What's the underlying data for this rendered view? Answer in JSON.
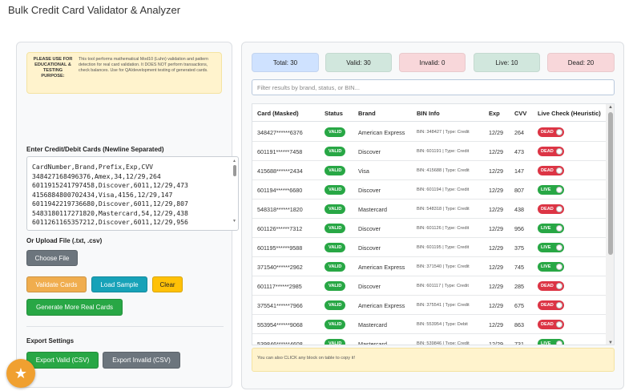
{
  "app": {
    "title": "Bulk Credit Card Validator & Analyzer"
  },
  "notice": {
    "title": "PLEASE USE FOR EDUCATIONAL & TESTING PURPOSE:",
    "text": "This tool performs mathematical Mod10 (Luhn) validation and pattern detection for real card validation. It DOES NOT perform transactions, check balances. Use for QA/development testing of generated cards."
  },
  "input": {
    "label": "Enter Credit/Debit Cards (Newline Separated)",
    "lines": [
      "CardNumber,Brand,Prefix,Exp,CVV",
      "348427168496376,Amex,34,12/29,264",
      "6011915241797458,Discover,6011,12/29,473",
      "4156884800702434,Visa,4156,12/29,147",
      "6011942219736680,Discover,6011,12/29,807",
      "5483180117271820,Mastercard,54,12/29,438",
      "6011261165357212,Discover,6011,12/29,956"
    ]
  },
  "upload": {
    "label": "Or Upload File (.txt, .csv)",
    "choose_label": "Choose File"
  },
  "actions": {
    "validate": "Validate Cards",
    "sample": "Load Sample",
    "clear": "Clear",
    "more": "Generate More Real Cards"
  },
  "export": {
    "label": "Export Settings",
    "valid": "Export Valid (CSV)",
    "invalid": "Export Invalid (CSV)"
  },
  "fab": {
    "icon": "star-icon",
    "glyph": "★"
  },
  "stats": {
    "total": "Total: 30",
    "valid": "Valid: 30",
    "invalid": "Invalid: 0",
    "live": "Live: 10",
    "dead": "Dead: 20"
  },
  "filter": {
    "placeholder": "Filter results by brand, status, or BIN..."
  },
  "table": {
    "headers": {
      "card": "Card (Masked)",
      "status": "Status",
      "brand": "Brand",
      "bin": "BIN Info",
      "exp": "Exp",
      "cvv": "CVV",
      "live": "Live Check (Heuristic)"
    },
    "rows": [
      {
        "card": "348427******6376",
        "status": "VALID",
        "brand": "American Express",
        "bin": "BIN: 348427 | Type: Credit",
        "exp": "12/29",
        "cvv": "264",
        "live": "DEAD"
      },
      {
        "card": "601191******7458",
        "status": "VALID",
        "brand": "Discover",
        "bin": "BIN: 601191 | Type: Credit",
        "exp": "12/29",
        "cvv": "473",
        "live": "DEAD"
      },
      {
        "card": "415688******2434",
        "status": "VALID",
        "brand": "Visa",
        "bin": "BIN: 415688 | Type: Credit",
        "exp": "12/29",
        "cvv": "147",
        "live": "DEAD"
      },
      {
        "card": "601194******6680",
        "status": "VALID",
        "brand": "Discover",
        "bin": "BIN: 601194 | Type: Credit",
        "exp": "12/29",
        "cvv": "807",
        "live": "LIVE"
      },
      {
        "card": "548318******1820",
        "status": "VALID",
        "brand": "Mastercard",
        "bin": "BIN: 548318 | Type: Credit",
        "exp": "12/29",
        "cvv": "438",
        "live": "DEAD"
      },
      {
        "card": "601126******7312",
        "status": "VALID",
        "brand": "Discover",
        "bin": "BIN: 601126 | Type: Credit",
        "exp": "12/29",
        "cvv": "956",
        "live": "LIVE"
      },
      {
        "card": "601195******9588",
        "status": "VALID",
        "brand": "Discover",
        "bin": "BIN: 601195 | Type: Credit",
        "exp": "12/29",
        "cvv": "375",
        "live": "LIVE"
      },
      {
        "card": "371540******2962",
        "status": "VALID",
        "brand": "American Express",
        "bin": "BIN: 371540 | Type: Credit",
        "exp": "12/29",
        "cvv": "745",
        "live": "LIVE"
      },
      {
        "card": "601117******2985",
        "status": "VALID",
        "brand": "Discover",
        "bin": "BIN: 601117 | Type: Credit",
        "exp": "12/29",
        "cvv": "285",
        "live": "DEAD"
      },
      {
        "card": "375541******7966",
        "status": "VALID",
        "brand": "American Express",
        "bin": "BIN: 375541 | Type: Credit",
        "exp": "12/29",
        "cvv": "675",
        "live": "DEAD"
      },
      {
        "card": "553954******9068",
        "status": "VALID",
        "brand": "Mastercard",
        "bin": "BIN: 553954 | Type: Debit",
        "exp": "12/29",
        "cvv": "863",
        "live": "DEAD"
      },
      {
        "card": "539846******4608",
        "status": "VALID",
        "brand": "Mastercard",
        "bin": "BIN: 539846 | Type: Credit",
        "exp": "12/29",
        "cvv": "731",
        "live": "LIVE"
      }
    ]
  },
  "tip": {
    "text": "You can also CLICK any block on table to copy it!"
  },
  "colors": {
    "valid": "#28a745",
    "dead": "#dc3545",
    "live": "#28a745",
    "accent": "#f0a030"
  }
}
